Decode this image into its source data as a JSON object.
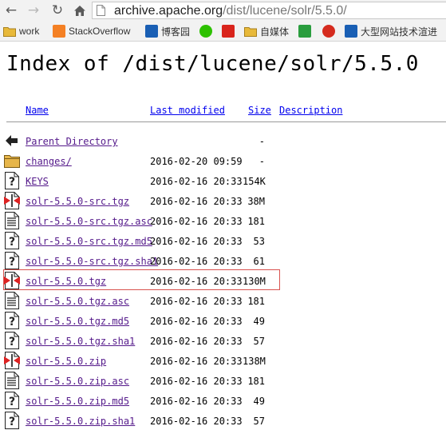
{
  "browser": {
    "url_host": "archive.apache.org",
    "url_path": "/dist/lucene/solr/5.5.0/"
  },
  "bookmarks": [
    {
      "label": "work",
      "icon": "folder-icon",
      "color": "#e8b93a"
    },
    {
      "label": "StackOverflow",
      "icon": "stackoverflow-icon",
      "color": "#f48024"
    },
    {
      "label": "博客园",
      "icon": "cnblogs-icon",
      "color": "#1a5fb4"
    },
    {
      "label": "",
      "icon": "wechat-icon",
      "color": "#2dc100"
    },
    {
      "label": "",
      "icon": "red-logo-icon",
      "color": "#d9241c"
    },
    {
      "label": "自媒体",
      "icon": "folder-icon",
      "color": "#e8b93a"
    },
    {
      "label": "",
      "icon": "segmentfault-icon",
      "color": "#2a9d3e"
    },
    {
      "label": "",
      "icon": "weibo-icon",
      "color": "#d52b1e"
    },
    {
      "label": "大型网站技术渲进",
      "icon": "site-icon",
      "color": "#1a5fb4"
    }
  ],
  "page": {
    "title": "Index of /dist/lucene/solr/5.5.0",
    "columns": {
      "name": "Name",
      "last_modified": "Last modified",
      "size": "Size",
      "description": "Description"
    },
    "entries": [
      {
        "name": "Parent Directory",
        "date": "",
        "size": "-",
        "icon": "back-icon"
      },
      {
        "name": "changes/",
        "date": "2016-02-20 09:59",
        "size": "-",
        "icon": "folder-icon"
      },
      {
        "name": "KEYS",
        "date": "2016-02-16 20:33",
        "size": "154K",
        "icon": "unknown-file-icon"
      },
      {
        "name": "solr-5.5.0-src.tgz",
        "date": "2016-02-16 20:33",
        "size": "38M",
        "icon": "archive-icon"
      },
      {
        "name": "solr-5.5.0-src.tgz.asc",
        "date": "2016-02-16 20:33",
        "size": "181",
        "icon": "text-file-icon"
      },
      {
        "name": "solr-5.5.0-src.tgz.md5",
        "date": "2016-02-16 20:33",
        "size": "53",
        "icon": "unknown-file-icon"
      },
      {
        "name": "solr-5.5.0-src.tgz.sha1",
        "date": "2016-02-16 20:33",
        "size": "61",
        "icon": "unknown-file-icon"
      },
      {
        "name": "solr-5.5.0.tgz",
        "date": "2016-02-16 20:33",
        "size": "130M",
        "icon": "archive-icon"
      },
      {
        "name": "solr-5.5.0.tgz.asc",
        "date": "2016-02-16 20:33",
        "size": "181",
        "icon": "text-file-icon"
      },
      {
        "name": "solr-5.5.0.tgz.md5",
        "date": "2016-02-16 20:33",
        "size": "49",
        "icon": "unknown-file-icon"
      },
      {
        "name": "solr-5.5.0.tgz.sha1",
        "date": "2016-02-16 20:33",
        "size": "57",
        "icon": "unknown-file-icon"
      },
      {
        "name": "solr-5.5.0.zip",
        "date": "2016-02-16 20:33",
        "size": "138M",
        "icon": "archive-icon"
      },
      {
        "name": "solr-5.5.0.zip.asc",
        "date": "2016-02-16 20:33",
        "size": "181",
        "icon": "text-file-icon"
      },
      {
        "name": "solr-5.5.0.zip.md5",
        "date": "2016-02-16 20:33",
        "size": "49",
        "icon": "unknown-file-icon"
      },
      {
        "name": "solr-5.5.0.zip.sha1",
        "date": "2016-02-16 20:33",
        "size": "57",
        "icon": "unknown-file-icon"
      }
    ]
  }
}
